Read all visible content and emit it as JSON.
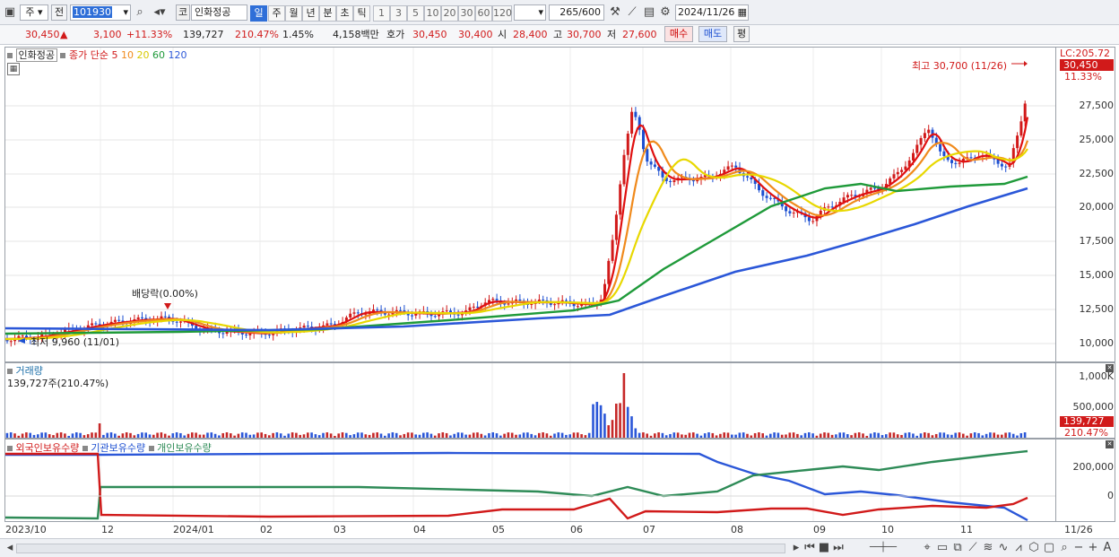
{
  "toolbar": {
    "market": "주",
    "prefix": "전",
    "code": "101930",
    "co_badge": "코",
    "name": "인화정공",
    "periods": [
      "일",
      "주",
      "월",
      "년",
      "분",
      "초",
      "틱"
    ],
    "selected_period": "일",
    "intervals": [
      "1",
      "3",
      "5",
      "10",
      "20",
      "30",
      "60",
      "120"
    ],
    "count": "265",
    "count_total": "/600",
    "date": "2024/11/26"
  },
  "quote": {
    "price": "30,450",
    "arrow": "▲",
    "change": "3,100",
    "rate": "+11.33%",
    "volume": "139,727",
    "volume_rate": "210.47%",
    "turnover_pct": "1.45%",
    "amount": "4,158백만",
    "bid_label": "호가",
    "ask": "30,450",
    "bid": "30,400",
    "open_label": "시",
    "open": "28,400",
    "high_label": "고",
    "high": "30,700",
    "low_label": "저",
    "low": "27,600",
    "buy": "매수",
    "sell": "매도",
    "eval": "평"
  },
  "price_panel": {
    "stock_label": "인화정공",
    "ma_label": "종가 단순",
    "ma": [
      {
        "period": "5",
        "color": "#e01010"
      },
      {
        "period": "10",
        "color": "#f08a1c"
      },
      {
        "period": "20",
        "color": "#e8d800"
      },
      {
        "period": "60",
        "color": "#1f9a3a"
      },
      {
        "period": "120",
        "color": "#2b57d8"
      }
    ],
    "lc": "LC:205.72",
    "last_price": "30,450",
    "last_rate": "11.33%",
    "high_note": "최고 30,700 (11/26)",
    "low_note": "최저 9,960 (11/01)",
    "dividend_note": "배당락(0.00%)",
    "yticks": [
      "27,500",
      "25,000",
      "22,500",
      "20,000",
      "17,500",
      "15,000",
      "12,500",
      "10,000"
    ]
  },
  "volume_panel": {
    "label": "거래량",
    "value_note": "139,727주(210.47%)",
    "yticks": [
      "1,000K",
      "500,000"
    ],
    "last": "139,727",
    "last_rate": "210.47%"
  },
  "holdings_panel": {
    "legends": [
      {
        "label": "외국인보유수량",
        "color": "#d11a1a"
      },
      {
        "label": "기관보유수량",
        "color": "#2b57d8"
      },
      {
        "label": "개인보유수량",
        "color": "#2e8b57"
      }
    ],
    "yticks": [
      "200,000",
      "0"
    ]
  },
  "xaxis": [
    "2023/10",
    "12",
    "2024/01",
    "02",
    "03",
    "04",
    "05",
    "06",
    "07",
    "08",
    "09",
    "10",
    "11",
    "11/26"
  ]
}
